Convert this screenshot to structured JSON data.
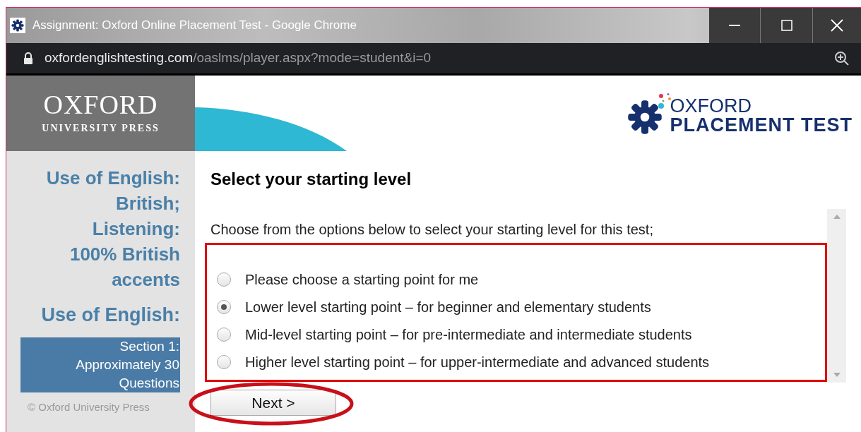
{
  "window": {
    "title": "Assignment: Oxford Online Placement Test - Google Chrome"
  },
  "address_bar": {
    "domain": "oxfordenglishtesting.com",
    "path": "/oaslms/player.aspx?mode=student&i=0"
  },
  "publisher_logo": {
    "name": "OXFORD",
    "subtitle": "UNIVERSITY PRESS"
  },
  "product_logo": {
    "line_1": "OXFORD",
    "line_2": "PLACEMENT TEST"
  },
  "sidebar": {
    "test_title": "Use of English: British; Listening: 100% British accents",
    "section_heading": "Use of English:",
    "items": [
      {
        "label": "Section 1: Approximately 30 Questions",
        "selected": true
      }
    ],
    "copyright": "© Oxford University Press"
  },
  "page": {
    "heading": "Select your starting level",
    "instruction": "Choose from the options below to select your starting level for this test;",
    "options": [
      {
        "label": "Please choose a starting point for me",
        "selected": false
      },
      {
        "label": "Lower level starting point – for beginner and elementary students",
        "selected": true
      },
      {
        "label": "Mid-level starting point – for pre-intermediate and intermediate students",
        "selected": false
      },
      {
        "label": "Higher level starting point – for upper-intermediate and advanced students",
        "selected": false
      }
    ],
    "next_button": "Next >"
  }
}
